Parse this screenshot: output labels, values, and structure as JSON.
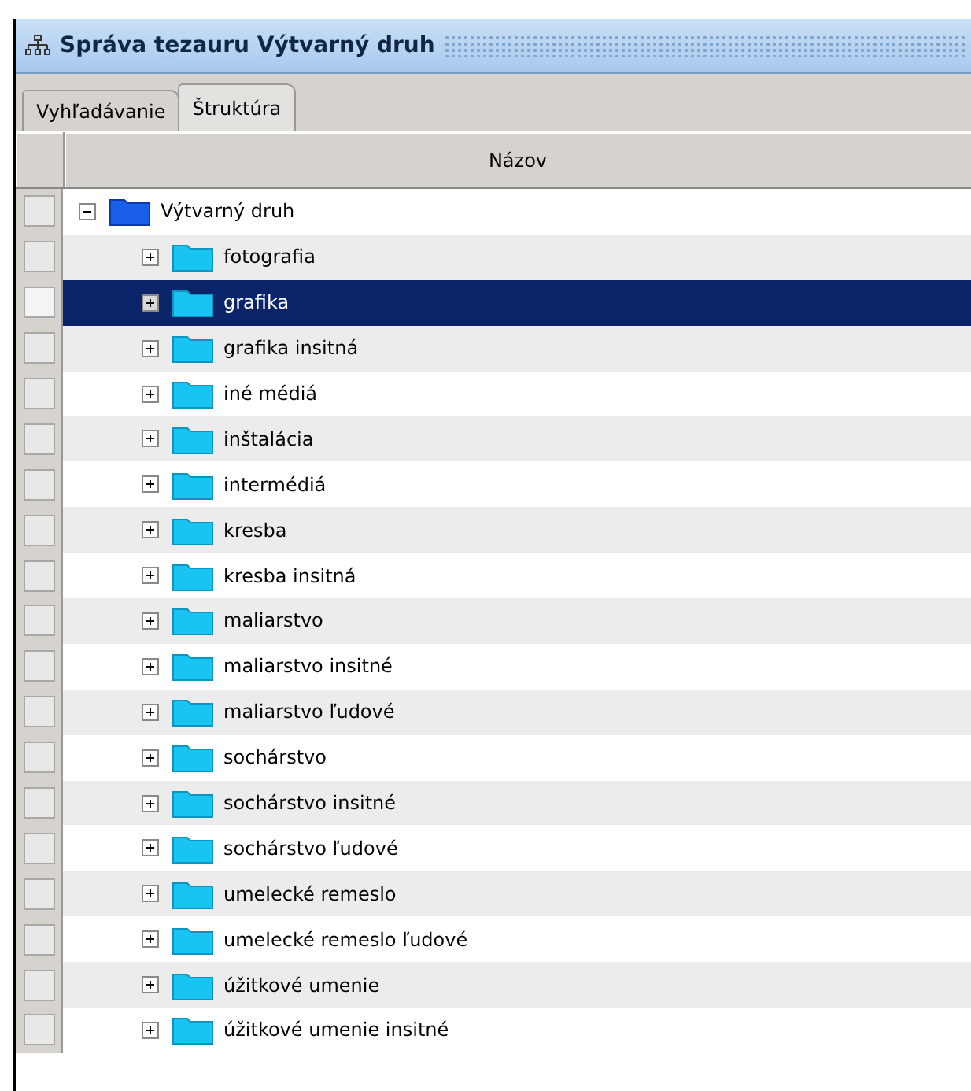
{
  "window": {
    "title": "Správa tezauru Výtvarný druh"
  },
  "tabs": [
    {
      "label": "Vyhľadávanie",
      "selected": false
    },
    {
      "label": "Štruktúra",
      "selected": true
    }
  ],
  "table": {
    "columns": [
      "Názov"
    ],
    "tree": [
      {
        "label": "Výtvarný druh",
        "expanded": true,
        "selected": false,
        "checked": false,
        "children": [
          {
            "label": "fotografia",
            "expanded": false,
            "selected": false,
            "checked": false
          },
          {
            "label": "grafika",
            "expanded": false,
            "selected": true,
            "checked": false
          },
          {
            "label": "grafika insitná",
            "expanded": false,
            "selected": false,
            "checked": false
          },
          {
            "label": "iné médiá",
            "expanded": false,
            "selected": false,
            "checked": false
          },
          {
            "label": "inštalácia",
            "expanded": false,
            "selected": false,
            "checked": false
          },
          {
            "label": "intermédiá",
            "expanded": false,
            "selected": false,
            "checked": false
          },
          {
            "label": "kresba",
            "expanded": false,
            "selected": false,
            "checked": false
          },
          {
            "label": "kresba insitná",
            "expanded": false,
            "selected": false,
            "checked": false
          },
          {
            "label": "maliarstvo",
            "expanded": false,
            "selected": false,
            "checked": false
          },
          {
            "label": "maliarstvo insitné",
            "expanded": false,
            "selected": false,
            "checked": false
          },
          {
            "label": "maliarstvo ľudové",
            "expanded": false,
            "selected": false,
            "checked": false
          },
          {
            "label": "sochárstvo",
            "expanded": false,
            "selected": false,
            "checked": false
          },
          {
            "label": "sochárstvo insitné",
            "expanded": false,
            "selected": false,
            "checked": false
          },
          {
            "label": "sochárstvo ľudové",
            "expanded": false,
            "selected": false,
            "checked": false
          },
          {
            "label": "umelecké remeslo",
            "expanded": false,
            "selected": false,
            "checked": false
          },
          {
            "label": "umelecké remeslo ľudové",
            "expanded": false,
            "selected": false,
            "checked": false
          },
          {
            "label": "úžitkové umenie",
            "expanded": false,
            "selected": false,
            "checked": false
          },
          {
            "label": "úžitkové umenie insitné",
            "expanded": false,
            "selected": false,
            "checked": false
          }
        ]
      }
    ]
  }
}
